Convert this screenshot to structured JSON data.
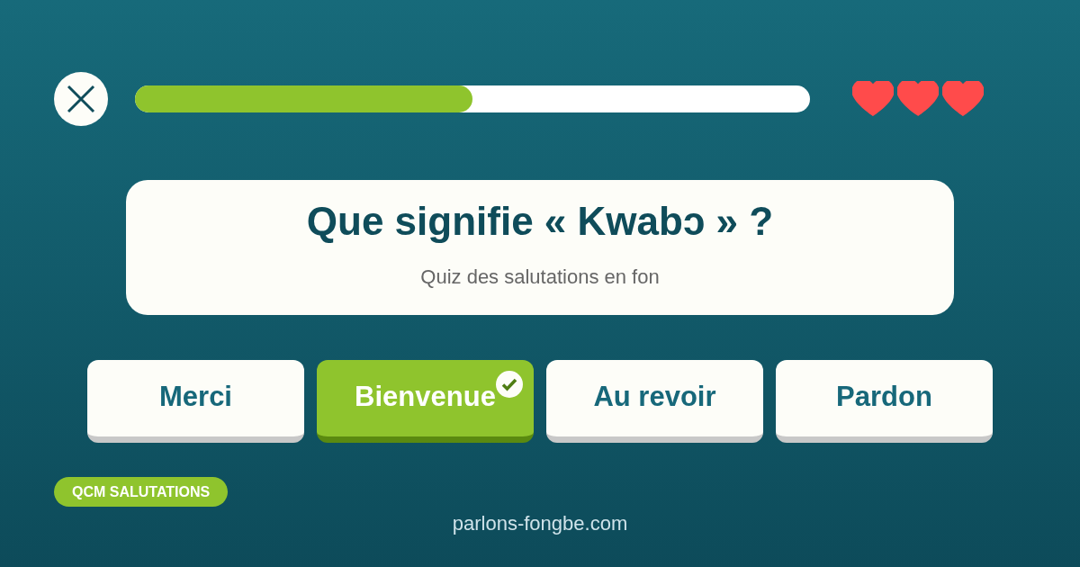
{
  "progress": {
    "level": 0.5
  },
  "hearts": [
    {
      "filled": true
    },
    {
      "filled": true
    },
    {
      "filled": true
    }
  ],
  "question": {
    "title": "Que signifie « Kwabɔ » ?",
    "subtitle": "Quiz des salutations en fon"
  },
  "options": [
    {
      "label": "Merci",
      "selected": false
    },
    {
      "label": "Bienvenue",
      "selected": true
    },
    {
      "label": "Au revoir",
      "selected": false
    },
    {
      "label": "Pardon",
      "selected": false
    }
  ],
  "tag": "QCM SALUTATIONS",
  "footer": "parlons-fongbe.com"
}
